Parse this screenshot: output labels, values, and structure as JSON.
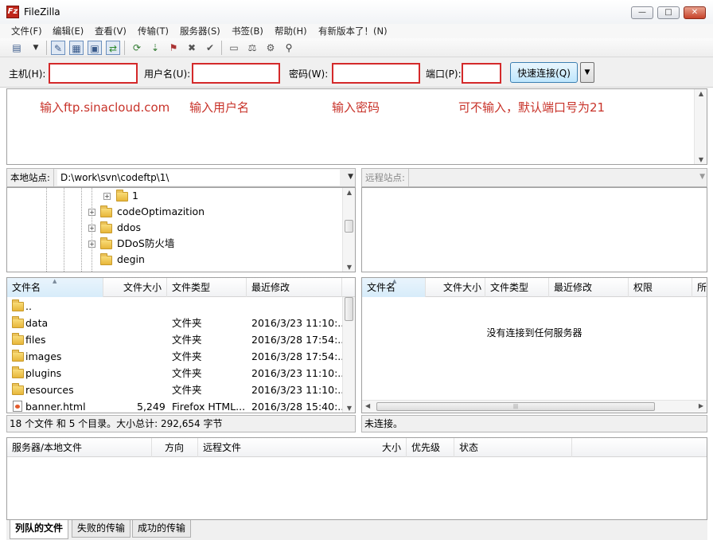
{
  "window": {
    "title": "FileZilla",
    "icon_letter": "Fz",
    "controls": {
      "minimize": "—",
      "maximize": "□",
      "close": "✕"
    }
  },
  "menu": [
    "文件(F)",
    "编辑(E)",
    "查看(V)",
    "传输(T)",
    "服务器(S)",
    "书签(B)",
    "帮助(H)",
    "有新版本了！(N)"
  ],
  "toolbar": {
    "icons": [
      "site-manager-icon",
      "dropdown-arrow-icon",
      "toggle-log-icon",
      "toggle-local-tree-icon",
      "toggle-remote-tree-icon",
      "toggle-queue-icon",
      "refresh-icon",
      "process-queue-icon",
      "cancel-icon",
      "disconnect-icon",
      "reconnect-icon",
      "directory-listing-filter-icon",
      "compare-icon",
      "sync-browse-icon",
      "search-icon"
    ]
  },
  "quickconnect": {
    "host_label": "主机(H):",
    "user_label": "用户名(U):",
    "pass_label": "密码(W):",
    "port_label": "端口(P):",
    "host_value": "",
    "user_value": "",
    "pass_value": "",
    "port_value": "",
    "button": "快速连接(Q)",
    "dropdown": "▼"
  },
  "annotations": {
    "host": "输入ftp.sinacloud.com",
    "user": "输入用户名",
    "pass": "输入密码",
    "port": "可不输入，默认端口号为21"
  },
  "local_site": {
    "label": "本地站点:",
    "path": "D:\\work\\svn\\codeftp\\1\\"
  },
  "remote_site": {
    "label": "远程站点:",
    "path": ""
  },
  "local_tree": [
    {
      "name": "1",
      "expander": "+"
    },
    {
      "name": "codeOptimazition",
      "expander": "+"
    },
    {
      "name": "ddos",
      "expander": "+"
    },
    {
      "name": "DDoS防火墙",
      "expander": "+"
    },
    {
      "name": "degin",
      "expander": ""
    }
  ],
  "local_files": {
    "columns": [
      "文件名",
      "文件大小",
      "文件类型",
      "最近修改"
    ],
    "rows": [
      {
        "name": "..",
        "size": "",
        "type": "",
        "modified": ""
      },
      {
        "name": "data",
        "size": "",
        "type": "文件夹",
        "modified": "2016/3/23 11:10:..."
      },
      {
        "name": "files",
        "size": "",
        "type": "文件夹",
        "modified": "2016/3/28 17:54:..."
      },
      {
        "name": "images",
        "size": "",
        "type": "文件夹",
        "modified": "2016/3/28 17:54:..."
      },
      {
        "name": "plugins",
        "size": "",
        "type": "文件夹",
        "modified": "2016/3/23 11:10:..."
      },
      {
        "name": "resources",
        "size": "",
        "type": "文件夹",
        "modified": "2016/3/23 11:10:..."
      },
      {
        "name": "banner.html",
        "size": "5,249",
        "type": "Firefox HTML...",
        "modified": "2016/3/28 15:40:..."
      }
    ],
    "status": "18 个文件 和 5 个目录。大小总计: 292,654 字节"
  },
  "remote_files": {
    "columns": [
      "文件名",
      "文件大小",
      "文件类型",
      "最近修改",
      "权限",
      "所"
    ],
    "empty_message": "没有连接到任何服务器",
    "status": "未连接。"
  },
  "queue": {
    "columns": [
      "服务器/本地文件",
      "方向",
      "远程文件",
      "大小",
      "优先级",
      "状态"
    ],
    "tabs": [
      "列队的文件",
      "失败的传输",
      "成功的传输"
    ]
  },
  "colors": {
    "annotation": "#c8332a",
    "highlight_border": "#d4292a",
    "folder": "#e7b63a"
  }
}
